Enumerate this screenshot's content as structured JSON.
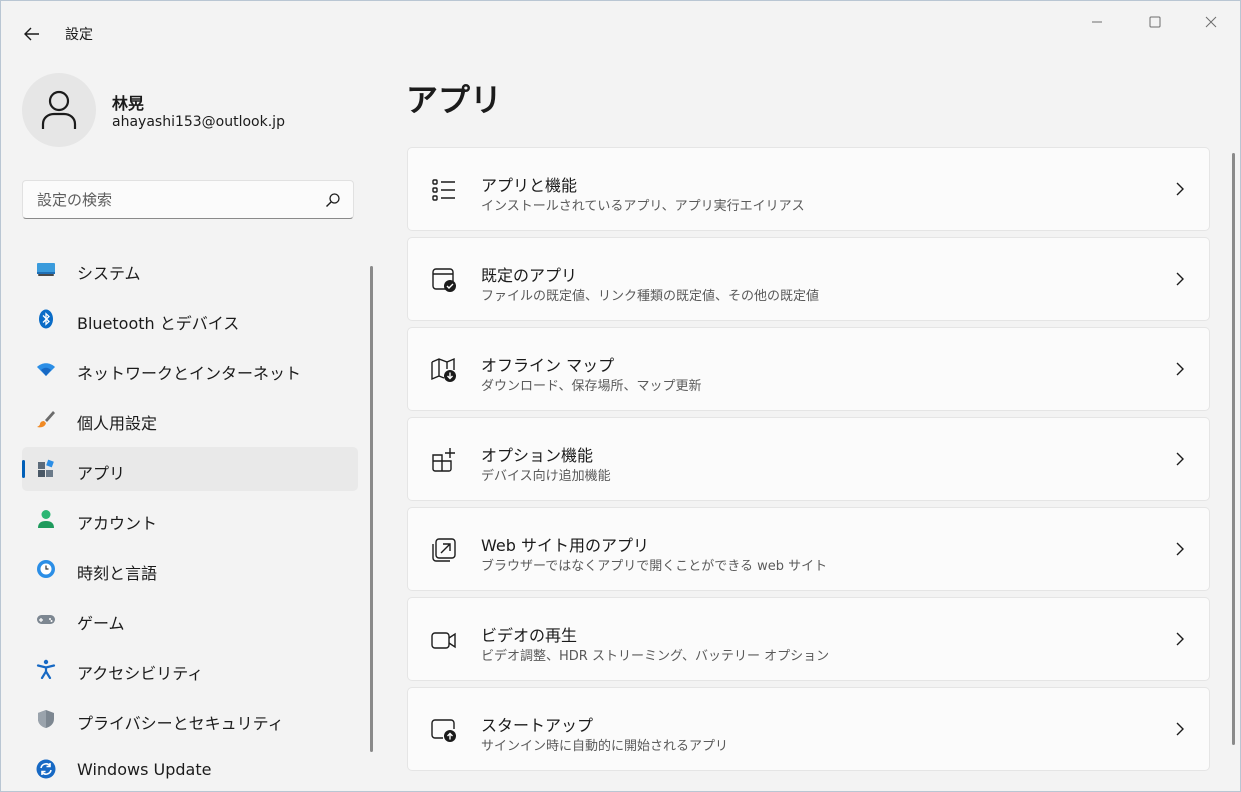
{
  "window": {
    "title": "設定"
  },
  "profile": {
    "name": "林晃",
    "email": "ahayashi153@outlook.jp"
  },
  "search": {
    "placeholder": "設定の検索"
  },
  "sidebar": {
    "items": [
      {
        "label": "システム",
        "icon": "system-icon"
      },
      {
        "label": "Bluetooth とデバイス",
        "icon": "bluetooth-icon"
      },
      {
        "label": "ネットワークとインターネット",
        "icon": "wifi-icon"
      },
      {
        "label": "個人用設定",
        "icon": "brush-icon"
      },
      {
        "label": "アプリ",
        "icon": "apps-icon",
        "active": true
      },
      {
        "label": "アカウント",
        "icon": "account-icon"
      },
      {
        "label": "時刻と言語",
        "icon": "globe-clock-icon"
      },
      {
        "label": "ゲーム",
        "icon": "gamepad-icon"
      },
      {
        "label": "アクセシビリティ",
        "icon": "accessibility-icon"
      },
      {
        "label": "プライバシーとセキュリティ",
        "icon": "shield-icon"
      },
      {
        "label": "Windows Update",
        "icon": "update-icon"
      }
    ]
  },
  "main": {
    "title": "アプリ",
    "cards": [
      {
        "title": "アプリと機能",
        "subtitle": "インストールされているアプリ、アプリ実行エイリアス",
        "icon": "list-icon"
      },
      {
        "title": "既定のアプリ",
        "subtitle": "ファイルの既定値、リンク種類の既定値、その他の既定値",
        "icon": "default-apps-icon"
      },
      {
        "title": "オフライン マップ",
        "subtitle": "ダウンロード、保存場所、マップ更新",
        "icon": "map-download-icon"
      },
      {
        "title": "オプション機能",
        "subtitle": "デバイス向け追加機能",
        "icon": "add-feature-icon"
      },
      {
        "title": "Web サイト用のアプリ",
        "subtitle": "ブラウザーではなくアプリで開くことができる web サイト",
        "icon": "open-external-icon"
      },
      {
        "title": "ビデオの再生",
        "subtitle": "ビデオ調整、HDR ストリーミング、バッテリー オプション",
        "icon": "video-icon"
      },
      {
        "title": "スタートアップ",
        "subtitle": "サインイン時に自動的に開始されるアプリ",
        "icon": "startup-icon"
      }
    ]
  },
  "colors": {
    "accent": "#005fb8",
    "background": "#f3f3f3",
    "card": "#fbfbfb"
  }
}
